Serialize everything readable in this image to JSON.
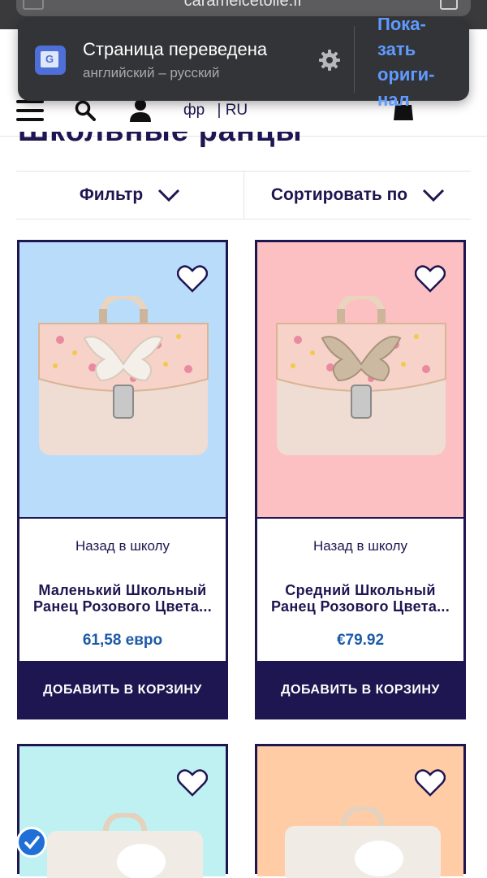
{
  "browser": {
    "url": "caramelcetoile.fr"
  },
  "translate_popup": {
    "title": "Страница переведена",
    "subtitle": "английский – русский",
    "show_original": "Пока-\nзать\nориги-\nнал"
  },
  "header": {
    "lang_current": "фр",
    "lang_sep": "|",
    "lang_other": "RU",
    "page_title": "Школьные ранцы"
  },
  "toolbar": {
    "filter_label": "Фильтр",
    "sort_label": "Сортировать по"
  },
  "products": [
    {
      "category": "Назад в школу",
      "name": "Маленький Школьный Ранец Розового Цвета...",
      "price": "61,58 евро",
      "add_label": "ДОБАВИТЬ В КОРЗИНУ",
      "bg": "#b9dcfb"
    },
    {
      "category": "Назад в школу",
      "name": "Средний Школьный Ранец Розового Цвета...",
      "price": "€79.92",
      "add_label": "ДОБАВИТЬ В КОРЗИНУ",
      "bg": "#fcc0c2"
    },
    {
      "bg": "#bff1f3"
    },
    {
      "bg": "#ffcca6"
    }
  ],
  "colors": {
    "brand_navy": "#1e1650",
    "price_blue": "#1d5aa8"
  }
}
